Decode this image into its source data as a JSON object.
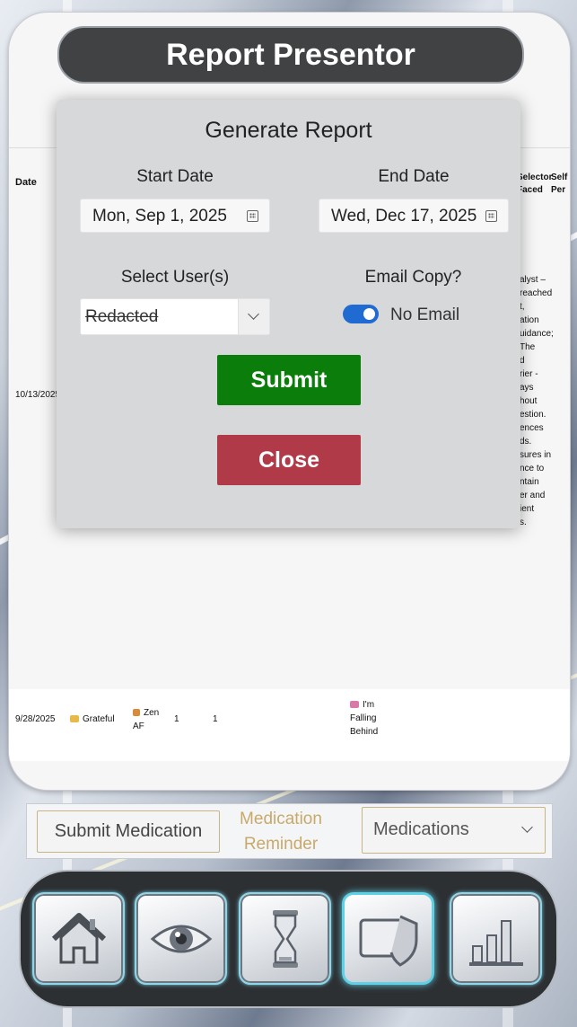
{
  "app": {
    "title": "Report Presentor"
  },
  "table": {
    "headers": {
      "date": "Date",
      "selector": "Selector Faced",
      "self": "Self Per"
    },
    "row1": {
      "date": "10/13/2025",
      "note_lines": [
        "alyst –",
        "reached",
        "t,",
        "ation",
        "uidance;",
        "The",
        "d",
        "rier -",
        "ays",
        "hout",
        "estion.",
        "ences",
        "ds.",
        "sures in",
        "nce to",
        "ntain",
        "er and",
        "ient",
        "s."
      ]
    },
    "row2": {
      "date": "9/28/2025",
      "mood": "Grateful",
      "activity": "Zen AF",
      "n1": "1",
      "n2": "1",
      "status": "I'm Falling Behind"
    }
  },
  "modal": {
    "title": "Generate Report",
    "start_label": "Start Date",
    "start_value": "Mon, Sep 1, 2025",
    "end_label": "End Date",
    "end_value": "Wed, Dec 17, 2025",
    "users_label": "Select User(s)",
    "users_value": "Redacted",
    "email_label": "Email Copy?",
    "email_toggle_on": true,
    "email_toggle_label": "No Email",
    "submit_label": "Submit",
    "close_label": "Close"
  },
  "medication": {
    "submit_label": "Submit Medication",
    "reminder_line1": "Medication",
    "reminder_line2": "Reminder",
    "select_value": "Medications"
  },
  "nav": {
    "items": [
      {
        "icon": "home-icon"
      },
      {
        "icon": "eye-icon"
      },
      {
        "icon": "hourglass-icon"
      },
      {
        "icon": "shield-card-icon",
        "active": true
      },
      {
        "icon": "bar-chart-icon"
      }
    ]
  },
  "colors": {
    "title_bar": "#404244",
    "submit": "#0a7d0a",
    "close": "#b03a48",
    "toggle": "#1f6bd1",
    "gold": "#c9a96a",
    "nav_glow": "#5ed1e6"
  }
}
